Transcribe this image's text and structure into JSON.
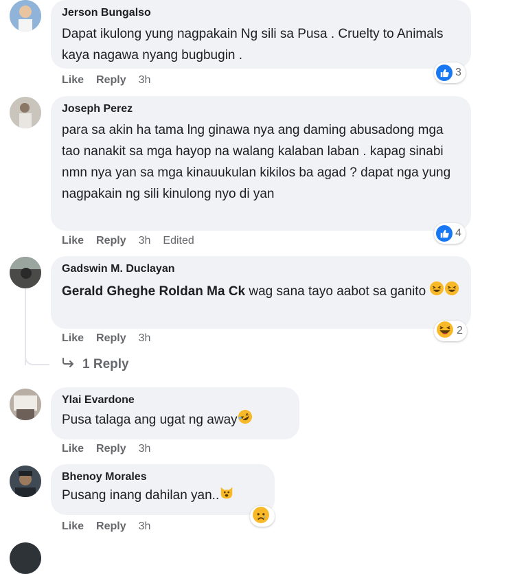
{
  "comments": [
    {
      "author": "Jerson Bungalso",
      "text": "Dapat ikulong yung nagpakain Ng sili sa Pusa . Cruelty to Animals kaya nagawa nyang bugbugin .",
      "actions": {
        "like": "Like",
        "reply": "Reply",
        "time": "3h"
      },
      "reaction": {
        "icon": "like-icon",
        "count": "3"
      }
    },
    {
      "author": "Joseph Perez",
      "text": "para sa akin ha tama lng ginawa nya ang daming abusadong mga tao nanakit sa mga hayop na walang kalaban laban . kapag sinabi nmn nya yan sa mga kinauukulan kikilos ba agad ? dapat nga yung nagpakain ng sili kinulong nyo di yan",
      "actions": {
        "like": "Like",
        "reply": "Reply",
        "time": "3h",
        "edited": "Edited"
      },
      "reaction": {
        "icon": "like-icon",
        "count": "4"
      }
    },
    {
      "author": "Gadswin M. Duclayan",
      "mention": "Gerald Gheghe Roldan Ma Ck",
      "text": " wag sana tayo aabot sa ganito",
      "emojis": [
        "grinning-squint-emoji",
        "grinning-squint-emoji"
      ],
      "actions": {
        "like": "Like",
        "reply": "Reply",
        "time": "3h"
      },
      "reaction": {
        "icon": "haha-icon",
        "count": "2"
      },
      "replies_link": "1 Reply"
    },
    {
      "author": "Ylai Evardone",
      "text": "Pusa talaga ang ugat ng away",
      "emojis": [
        "rofl-emoji"
      ],
      "actions": {
        "like": "Like",
        "reply": "Reply",
        "time": "3h"
      }
    },
    {
      "author": "Bhenoy Morales",
      "text": "Pusang inang dahilan yan..",
      "emojis": [
        "cat-face-emoji"
      ],
      "actions": {
        "like": "Like",
        "reply": "Reply",
        "time": "3h"
      },
      "reaction": {
        "icon": "sad-icon",
        "count": ""
      }
    }
  ],
  "colors": {
    "like_blue": "#1877f2",
    "bubble_bg": "#f0f2f5",
    "meta_gray": "#65676b",
    "haha_yellow": "#f7b928"
  }
}
